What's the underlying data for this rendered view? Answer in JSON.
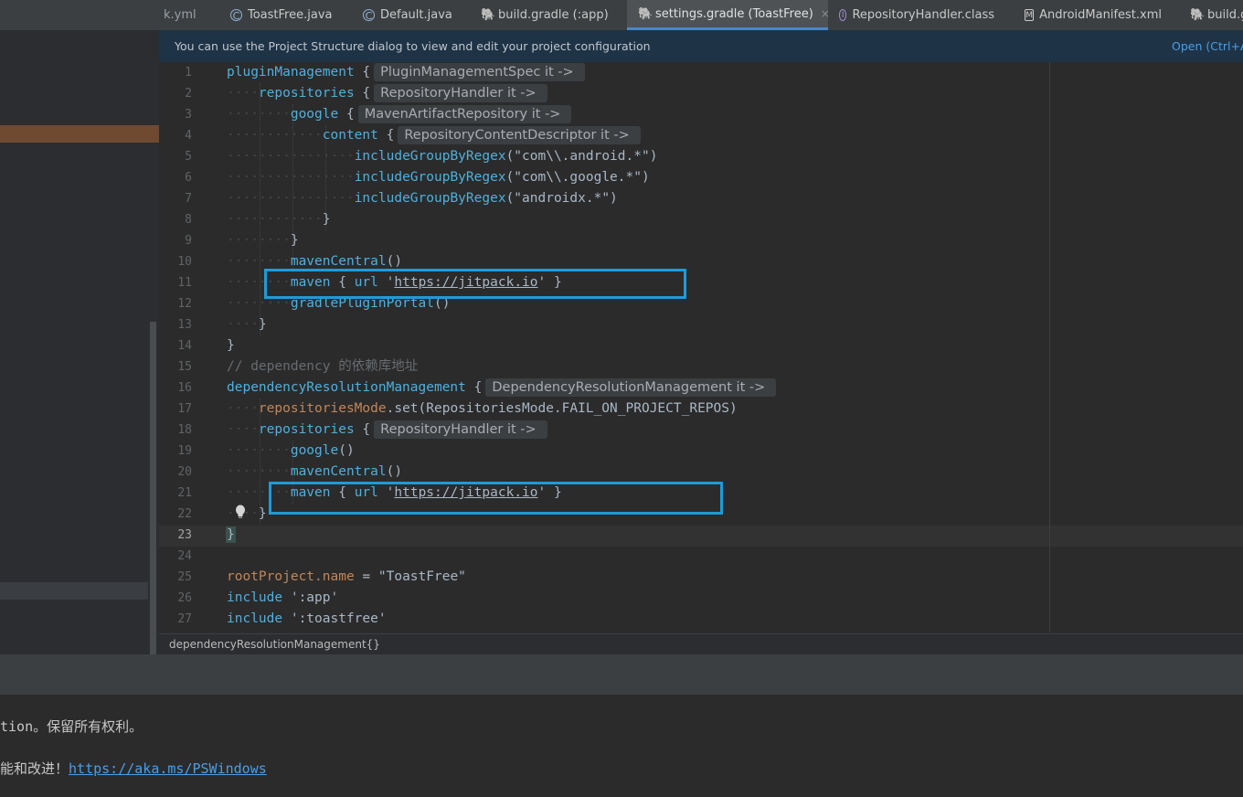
{
  "tabs": [
    {
      "label": "k.yml",
      "icon": "none"
    },
    {
      "label": "ToastFree.java",
      "icon": "class-icon"
    },
    {
      "label": "Default.java",
      "icon": "class-icon"
    },
    {
      "label": "build.gradle (:app)",
      "icon": "gradle-icon"
    },
    {
      "label": "settings.gradle (ToastFree)",
      "icon": "gradle-icon",
      "active": true,
      "close": "×"
    },
    {
      "label": "RepositoryHandler.class",
      "icon": "interface-icon"
    },
    {
      "label": "AndroidManifest.xml",
      "icon": "manifest-icon"
    },
    {
      "label": "build.g",
      "icon": "gradle-icon"
    }
  ],
  "notification": {
    "message": "You can use the Project Structure dialog to view and edit your project configuration",
    "link": "Open (Ctrl+A"
  },
  "editor": {
    "line_numbers": [
      "1",
      "2",
      "3",
      "4",
      "5",
      "6",
      "7",
      "8",
      "9",
      "10",
      "11",
      "12",
      "13",
      "14",
      "15",
      "16",
      "17",
      "18",
      "19",
      "20",
      "21",
      "22",
      "23",
      "24",
      "25",
      "26",
      "27"
    ],
    "current_line": "23",
    "lines": {
      "l1": {
        "code": "pluginManagement",
        "brace": " {",
        "hint": "PluginManagementSpec it ->"
      },
      "l2": {
        "code": "repositories",
        "brace": " {",
        "hint": "RepositoryHandler it ->"
      },
      "l3": {
        "code": "google",
        "brace": " {",
        "hint": "MavenArtifactRepository it ->"
      },
      "l4": {
        "code": "content",
        "brace": " {",
        "hint": "RepositoryContentDescriptor it ->"
      },
      "l5": {
        "fn": "includeGroupByRegex",
        "arg": "(\"com\\\\.android.*\")"
      },
      "l6": {
        "fn": "includeGroupByRegex",
        "arg": "(\"com\\\\.google.*\")"
      },
      "l7": {
        "fn": "includeGroupByRegex",
        "arg": "(\"androidx.*\")"
      },
      "l8": {
        "code": "}"
      },
      "l9": {
        "code": "}"
      },
      "l10": {
        "fn": "mavenCentral",
        "arg": "()"
      },
      "l11": {
        "fn": "maven",
        "mid": " { ",
        "fn2": "url",
        "q1": " '",
        "url": "https://jitpack.io",
        "q2": "' }"
      },
      "l12": {
        "fn": "gradlePluginPortal",
        "arg": "()"
      },
      "l13": {
        "code": "}"
      },
      "l14": {
        "code": "}"
      },
      "l15": {
        "comment": "// dependency 的依赖库地址"
      },
      "l16": {
        "code": "dependencyResolutionManagement",
        "brace": " {",
        "hint": "DependencyResolutionManagement it ->"
      },
      "l17": {
        "prop": "repositoriesMode",
        "rest": ".set(RepositoriesMode.FAIL_ON_PROJECT_REPOS)"
      },
      "l18": {
        "code": "repositories",
        "brace": " {",
        "hint": "RepositoryHandler it ->"
      },
      "l19": {
        "fn": "google",
        "arg": "()"
      },
      "l20": {
        "fn": "mavenCentral",
        "arg": "()"
      },
      "l21": {
        "fn": "maven",
        "mid": " { ",
        "fn2": "url",
        "q1": " '",
        "url": "https://jitpack.io",
        "q2": "' }"
      },
      "l22": {
        "code": "}"
      },
      "l23": {
        "code": "}"
      },
      "l25": {
        "prop": "rootProject.name",
        "rest": " = \"ToastFree\""
      },
      "l26": {
        "fn": "include",
        "arg": " ':app'"
      },
      "l27": {
        "fn": "include",
        "arg": " ':toastfree'"
      }
    }
  },
  "breadcrumb": "dependencyResolutionManagement{}",
  "terminal": {
    "line1": "tion。保留所有权利。",
    "line2_prefix": "能和改进！",
    "line2_link": "https://aka.ms/PSWindows"
  },
  "colors": {
    "highlight_box": "#1f9bd8",
    "active_tab_underline": "#4a88c7",
    "selected_project_row": "#6f4a31"
  }
}
